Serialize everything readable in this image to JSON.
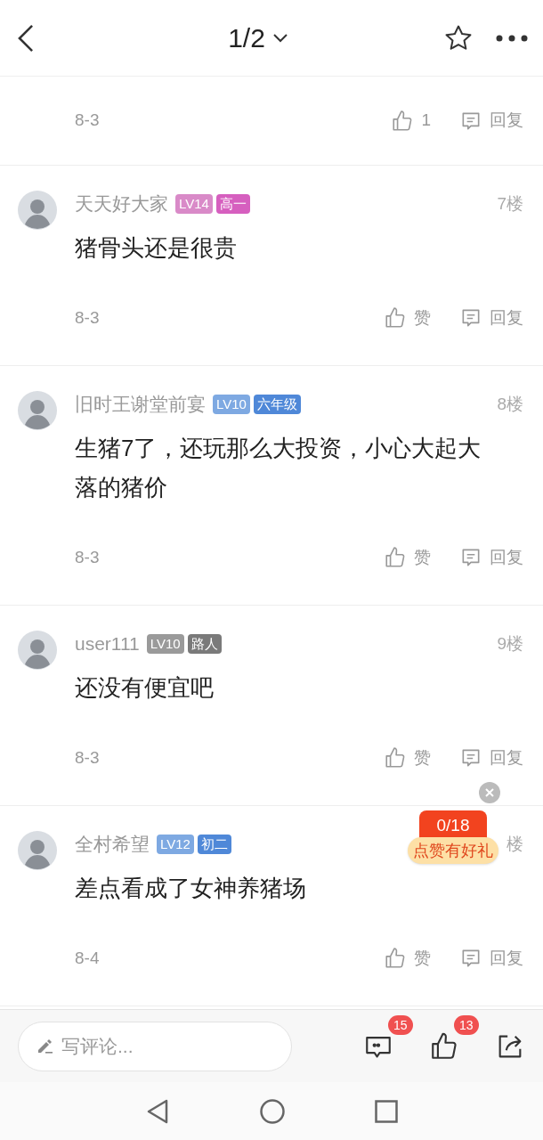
{
  "header": {
    "page": "1/2"
  },
  "first_row": {
    "date": "8-3",
    "like": "1",
    "reply": "回复"
  },
  "comments": [
    {
      "user": "天天好大家",
      "level": {
        "text": "LV14",
        "color": "#d98ac8"
      },
      "rank": {
        "text": "高一",
        "color": "#d65fbf"
      },
      "floor": "7楼",
      "text": "猪骨头还是很贵",
      "date": "8-3",
      "like": "赞",
      "reply": "回复"
    },
    {
      "user": "旧时王谢堂前宴",
      "level": {
        "text": "LV10",
        "color": "#7ea9e2"
      },
      "rank": {
        "text": "六年级",
        "color": "#4f88d8"
      },
      "floor": "8楼",
      "text": "生猪7了，还玩那么大投资，小心大起大落的猪价",
      "date": "8-3",
      "like": "赞",
      "reply": "回复"
    },
    {
      "user": "user111",
      "level": {
        "text": "LV10",
        "color": "#9a9a9a"
      },
      "rank": {
        "text": "路人",
        "color": "#7a7a7a"
      },
      "floor": "9楼",
      "text": "还没有便宜吧",
      "date": "8-3",
      "like": "赞",
      "reply": "回复"
    },
    {
      "user": "全村希望",
      "level": {
        "text": "LV12",
        "color": "#7ea9e2"
      },
      "rank": {
        "text": "初二",
        "color": "#4f88d8"
      },
      "floor": "楼",
      "text": "差点看成了女神养猪场",
      "date": "8-4",
      "like": "赞",
      "reply": "回复"
    }
  ],
  "promo": {
    "count": "0/18",
    "label": "点赞有好礼"
  },
  "bottom_bar": {
    "placeholder": "写评论...",
    "comments_badge": "15",
    "likes_badge": "13"
  }
}
